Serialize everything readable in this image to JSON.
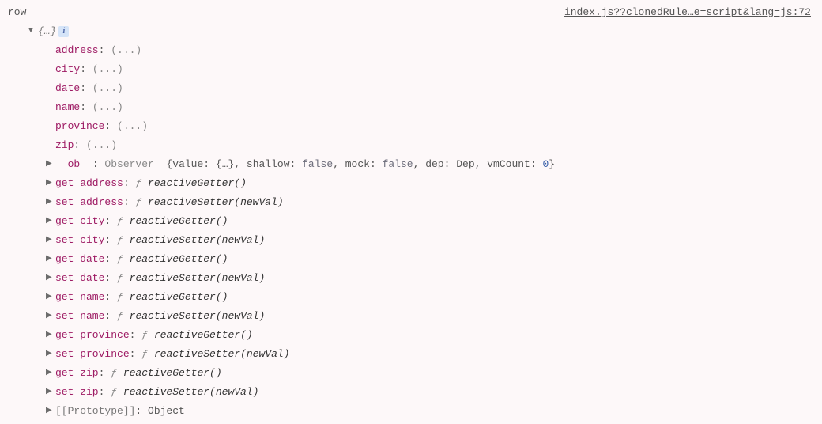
{
  "header": {
    "label": "row",
    "sourceLink": "index.js??clonedRule…e=script&lang=js:72"
  },
  "summary": {
    "braces": "{…}",
    "infoBadge": "i"
  },
  "simpleProps": [
    {
      "name": "address",
      "value": "(...)"
    },
    {
      "name": "city",
      "value": "(...)"
    },
    {
      "name": "date",
      "value": "(...)"
    },
    {
      "name": "name",
      "value": "(...)"
    },
    {
      "name": "province",
      "value": "(...)"
    },
    {
      "name": "zip",
      "value": "(...)"
    }
  ],
  "ob": {
    "key": "__ob__",
    "type": "Observer",
    "preview": "{value: {…}, shallow: false, mock: false, dep: Dep, vmCount: 0}"
  },
  "accessors": [
    {
      "kind": "get",
      "prop": "address",
      "fn": "reactiveGetter",
      "args": "()"
    },
    {
      "kind": "set",
      "prop": "address",
      "fn": "reactiveSetter",
      "args": "(newVal)"
    },
    {
      "kind": "get",
      "prop": "city",
      "fn": "reactiveGetter",
      "args": "()"
    },
    {
      "kind": "set",
      "prop": "city",
      "fn": "reactiveSetter",
      "args": "(newVal)"
    },
    {
      "kind": "get",
      "prop": "date",
      "fn": "reactiveGetter",
      "args": "()"
    },
    {
      "kind": "set",
      "prop": "date",
      "fn": "reactiveSetter",
      "args": "(newVal)"
    },
    {
      "kind": "get",
      "prop": "name",
      "fn": "reactiveGetter",
      "args": "()"
    },
    {
      "kind": "set",
      "prop": "name",
      "fn": "reactiveSetter",
      "args": "(newVal)"
    },
    {
      "kind": "get",
      "prop": "province",
      "fn": "reactiveGetter",
      "args": "()"
    },
    {
      "kind": "set",
      "prop": "province",
      "fn": "reactiveSetter",
      "args": "(newVal)"
    },
    {
      "kind": "get",
      "prop": "zip",
      "fn": "reactiveGetter",
      "args": "()"
    },
    {
      "kind": "set",
      "prop": "zip",
      "fn": "reactiveSetter",
      "args": "(newVal)"
    }
  ],
  "prototype": {
    "label": "[[Prototype]]",
    "value": "Object"
  },
  "tokens": {
    "f": "ƒ",
    "colon": ": ",
    "triCollapsed": "▶",
    "triExpanded": "▼",
    "valueKey": "value",
    "bracesShort": "{…}",
    "shallowKey": "shallow",
    "mockKey": "mock",
    "depKey": "dep",
    "depVal": "Dep",
    "vmCountKey": "vmCount",
    "falseVal": "false",
    "zero": "0",
    "comma": ", "
  }
}
